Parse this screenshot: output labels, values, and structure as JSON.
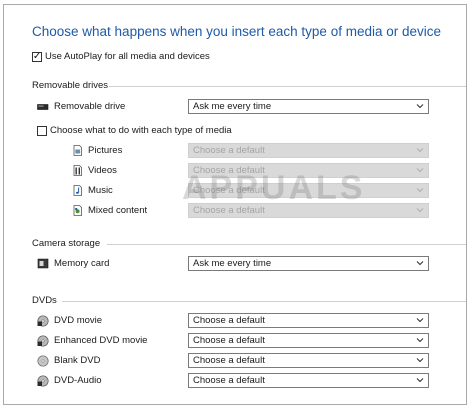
{
  "header": {
    "title": "Choose what happens when you insert each type of media or device"
  },
  "autoplay": {
    "label": "Use AutoPlay for all media and devices",
    "checked": true
  },
  "removable": {
    "heading": "Removable drives",
    "device_label": "Removable drive",
    "device_value": "Ask me every time",
    "choose_label": "Choose what to do with each type of media",
    "items": [
      {
        "label": "Pictures",
        "value": "Choose a default"
      },
      {
        "label": "Videos",
        "value": "Choose a default"
      },
      {
        "label": "Music",
        "value": "Choose a default"
      },
      {
        "label": "Mixed content",
        "value": "Choose a default"
      }
    ]
  },
  "camera": {
    "heading": "Camera storage",
    "items": [
      {
        "label": "Memory card",
        "value": "Ask me every time"
      }
    ]
  },
  "dvds": {
    "heading": "DVDs",
    "items": [
      {
        "label": "DVD movie",
        "value": "Choose a default"
      },
      {
        "label": "Enhanced DVD movie",
        "value": "Choose a default"
      },
      {
        "label": "Blank DVD",
        "value": "Choose a default"
      },
      {
        "label": "DVD-Audio",
        "value": "Choose a default"
      }
    ]
  },
  "watermark": {
    "text": "APPUALS"
  },
  "colors": {
    "title": "#1e5aa8",
    "disabled_dropdown": "#d9d9d9",
    "border": "#a9a9a9"
  }
}
